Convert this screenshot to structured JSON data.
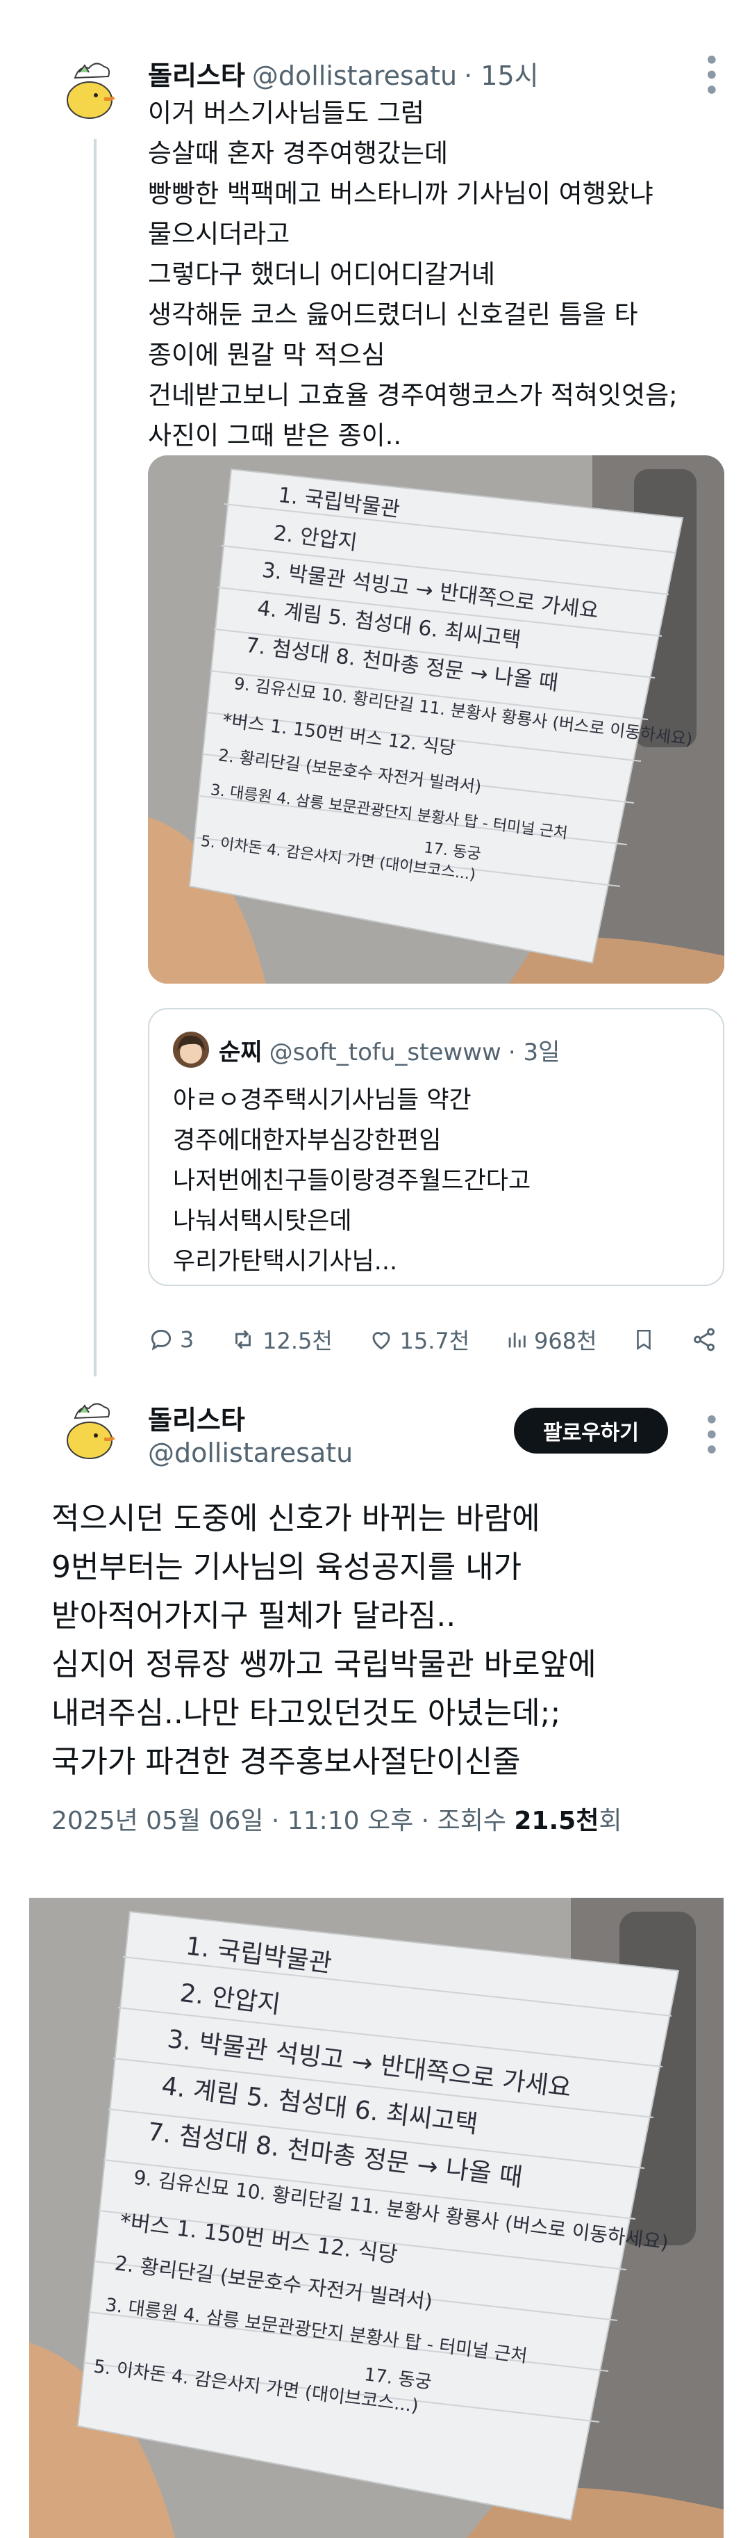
{
  "tweet1": {
    "author_name": "돌리스타",
    "author_handle": "@dollistaresatu",
    "time": "· 15시",
    "text": "이거 버스기사님들도 그럼\n승살때 혼자 경주여행갔는데\n빵빵한 백팩메고 버스타니까 기사님이 여행왔냐\n물으시더라고\n그렇다구 했더니 어디어디갈거녜\n생각해둔 코스 읊어드렸더니 신호걸린 틈을 타\n종이에 뭔갈 막 적으심\n건네받고보니 고효율 경주여행코스가 적혀잇엇음;\n사진이 그때 받은 종이..",
    "quote": {
      "author_name": "순찌",
      "author_handle": "@soft_tofu_stewww",
      "time": "· 3일",
      "text": "아ㄹㅇ경주택시기사님들 약간\n경주에대한자부심강한편임\n나저번에친구들이랑경주월드간다고\n나눠서택시탓은데\n우리가탄택시기사님..."
    },
    "actions": {
      "replies": "3",
      "retweets": "12.5천",
      "likes": "15.7천",
      "views": "968천"
    }
  },
  "tweet2": {
    "author_name": "돌리스타",
    "author_handle": "@dollistaresatu",
    "follow_label": "팔로우하기",
    "text": "적으시던 도중에 신호가 바뀌는 바람에\n9번부터는 기사님의 육성공지를 내가\n받아적어가지구 필체가 달라짐..\n심지어 정류장 쌩까고 국립박물관 바로앞에\n내려주심..나만 타고있던것도 아녔는데;;\n국가가 파견한 경주홍보사절단이신줄",
    "date": "2025년 05월 06일 · 11:10 오후 · 조회수 ",
    "views": "21.5천",
    "views_suffix": "회"
  },
  "note": {
    "lines": [
      "1. 국립박물관",
      "2. 안압지",
      "3. 박물관 석빙고 → 반대쪽으로 가세요",
      "4. 계림   5. 첨성대   6. 최씨고택",
      "7. 첨성대   8. 천마총 정문 → 나올 때",
      "9. 김유신묘  10. 황리단길  11. 분황사 황룡사 (버스로 이동하세요)",
      "*버스 1. 150번 버스  12. 식당",
      "2. 황리단길 (보문호수 자전거 빌려서)",
      "3. 대릉원  4. 삼릉 보문관광단지 분황사 탑 - 터미널 근처",
      "17. 동궁",
      "5. 이차돈  4. 감은사지 가면  (대이브코스...)"
    ]
  },
  "colors": {
    "text": "#0f1419",
    "secondary": "#536471",
    "border": "#cfd9de"
  }
}
